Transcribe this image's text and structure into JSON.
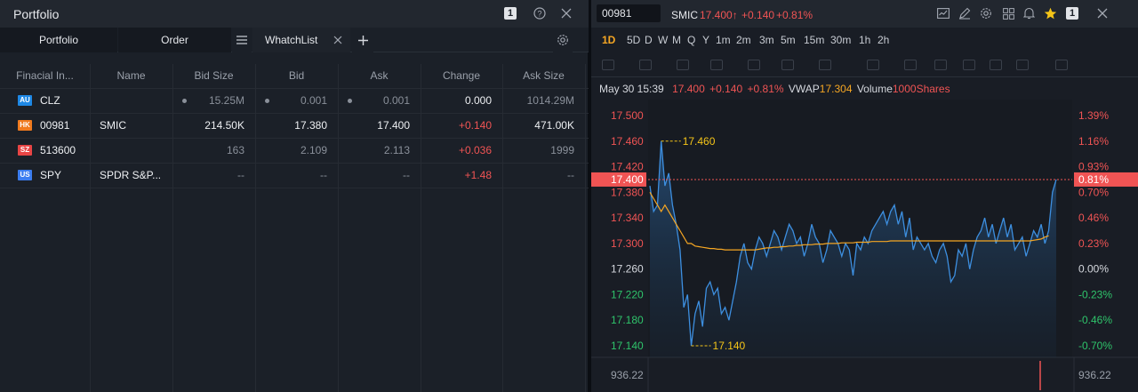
{
  "left_panel": {
    "title": "Portfolio",
    "badge": "1",
    "tabs": [
      "Portfolio",
      "Order",
      "WhatchList"
    ],
    "table": {
      "headers": [
        "Finacial In...",
        "Name",
        "Bid Size",
        "Bid",
        "Ask",
        "Change",
        "Ask Size"
      ],
      "rows": [
        {
          "market": "AU",
          "market_color": "#1e88e5",
          "symbol": "CLZ",
          "name": "",
          "bid_size": "15.25M",
          "bid": "0.001",
          "ask": "0.001",
          "change": "0.000",
          "ask_size": "1014.29M",
          "change_color": "#eef0f3",
          "dim": true
        },
        {
          "market": "HK",
          "market_color": "#f07a1e",
          "symbol": "00981",
          "name": "SMIC",
          "bid_size": "214.50K",
          "bid": "17.380",
          "ask": "17.400",
          "change": "+0.140",
          "ask_size": "471.00K",
          "change_color": "#f05454",
          "dim": false
        },
        {
          "market": "SZ",
          "market_color": "#e84545",
          "symbol": "513600",
          "name": "",
          "bid_size": "163",
          "bid": "2.109",
          "ask": "2.113",
          "change": "+0.036",
          "ask_size": "1999",
          "change_color": "#f05454",
          "dim": true
        },
        {
          "market": "US",
          "market_color": "#3b7df0",
          "symbol": "SPY",
          "name": "SPDR S&P...",
          "bid_size": "--",
          "bid": "--",
          "ask": "--",
          "change": "+1.48",
          "ask_size": "--",
          "change_color": "#f05454",
          "dim": true
        }
      ]
    }
  },
  "right_panel": {
    "symbol_input": "00981",
    "name": "SMIC",
    "price": "17.400",
    "change": "+0.140",
    "change_pct": "+0.81%",
    "badge": "1",
    "periods": [
      "1D",
      "5D",
      "D",
      "W",
      "M",
      "Q",
      "Y",
      "1m",
      "2m",
      "3m",
      "5m",
      "15m",
      "30m",
      "1h",
      "2h"
    ],
    "active_period": "1D",
    "info": {
      "datetime": "May 30 15:39",
      "price": "17.400",
      "change": "+0.140",
      "change_pct": "+0.81%",
      "vwap_label": "VWAP",
      "vwap": "17.304",
      "volume_label": "Volume",
      "volume": "1000Shares"
    }
  },
  "chart_data": {
    "type": "line",
    "title": "",
    "ylim": [
      17.14,
      17.5
    ],
    "y_ticks": [
      "17.500",
      "17.460",
      "17.420",
      "17.380",
      "17.340",
      "17.300",
      "17.260",
      "17.220",
      "17.180",
      "17.140"
    ],
    "pct_ticks": [
      "1.39%",
      "1.16%",
      "0.93%",
      "0.70%",
      "0.46%",
      "0.23%",
      "0.00%",
      "-0.23%",
      "-0.46%",
      "-0.70%"
    ],
    "last_price_label": "17.400",
    "last_pct_label": "0.81%",
    "last_price": 17.4,
    "high_label": "17.460",
    "high": 17.46,
    "low_label": "17.140",
    "low": 17.14,
    "volume_axis_label": "936.22",
    "volume_axis_label_right": "936.22",
    "series": [
      {
        "values": [
          17.39,
          17.35,
          17.36,
          17.46,
          17.39,
          17.41,
          17.36,
          17.33,
          17.29,
          17.2,
          17.22,
          17.14,
          17.19,
          17.21,
          17.17,
          17.23,
          17.24,
          17.22,
          17.23,
          17.19,
          17.2,
          17.18,
          17.21,
          17.24,
          17.28,
          17.3,
          17.27,
          17.26,
          17.29,
          17.31,
          17.3,
          17.28,
          17.3,
          17.32,
          17.31,
          17.29,
          17.31,
          17.33,
          17.32,
          17.3,
          17.31,
          17.28,
          17.3,
          17.33,
          17.31,
          17.3,
          17.27,
          17.29,
          17.32,
          17.31,
          17.3,
          17.28,
          17.3,
          17.29,
          17.25,
          17.3,
          17.29,
          17.31,
          17.3,
          17.32,
          17.33,
          17.34,
          17.35,
          17.33,
          17.35,
          17.36,
          17.33,
          17.35,
          17.31,
          17.34,
          17.29,
          17.31,
          17.3,
          17.29,
          17.3,
          17.28,
          17.27,
          17.29,
          17.3,
          17.28,
          17.24,
          17.25,
          17.29,
          17.28,
          17.3,
          17.26,
          17.29,
          17.31,
          17.32,
          17.34,
          17.31,
          17.33,
          17.3,
          17.32,
          17.34,
          17.31,
          17.33,
          17.29,
          17.3,
          17.31,
          17.28,
          17.3,
          17.32,
          17.31,
          17.33,
          17.3,
          17.32,
          17.38,
          17.4
        ],
        "color": "#3d8fe0"
      },
      {
        "values": [
          17.38,
          17.37,
          17.36,
          17.35,
          17.36,
          17.35,
          17.34,
          17.33,
          17.32,
          17.31,
          17.3,
          17.3,
          17.296,
          17.295,
          17.294,
          17.293,
          17.292,
          17.292,
          17.291,
          17.291,
          17.29,
          17.29,
          17.29,
          17.29,
          17.29,
          17.29,
          17.29,
          17.29,
          17.29,
          17.291,
          17.292,
          17.293,
          17.293,
          17.294,
          17.294,
          17.295,
          17.295,
          17.296,
          17.296,
          17.297,
          17.297,
          17.298,
          17.298,
          17.298,
          17.299,
          17.299,
          17.299,
          17.3,
          17.3,
          17.3,
          17.3,
          17.301,
          17.301,
          17.301,
          17.301,
          17.302,
          17.302,
          17.302,
          17.302,
          17.303,
          17.303,
          17.303,
          17.303,
          17.303,
          17.304,
          17.304,
          17.304,
          17.304,
          17.304,
          17.304,
          17.304,
          17.304,
          17.304,
          17.304,
          17.304,
          17.304,
          17.304,
          17.304,
          17.304,
          17.304,
          17.304,
          17.304,
          17.304,
          17.304,
          17.304,
          17.304,
          17.304,
          17.304,
          17.304,
          17.304,
          17.304,
          17.304,
          17.304,
          17.304,
          17.304,
          17.304,
          17.304,
          17.304,
          17.304,
          17.304,
          17.304,
          17.304,
          17.305,
          17.306,
          17.307,
          17.31,
          17.312
        ],
        "color": "#f5a623"
      }
    ]
  },
  "colors": {
    "up": "#f05454",
    "down": "#2fc46b",
    "accent": "#f5a623",
    "line": "#3d8fe0"
  }
}
